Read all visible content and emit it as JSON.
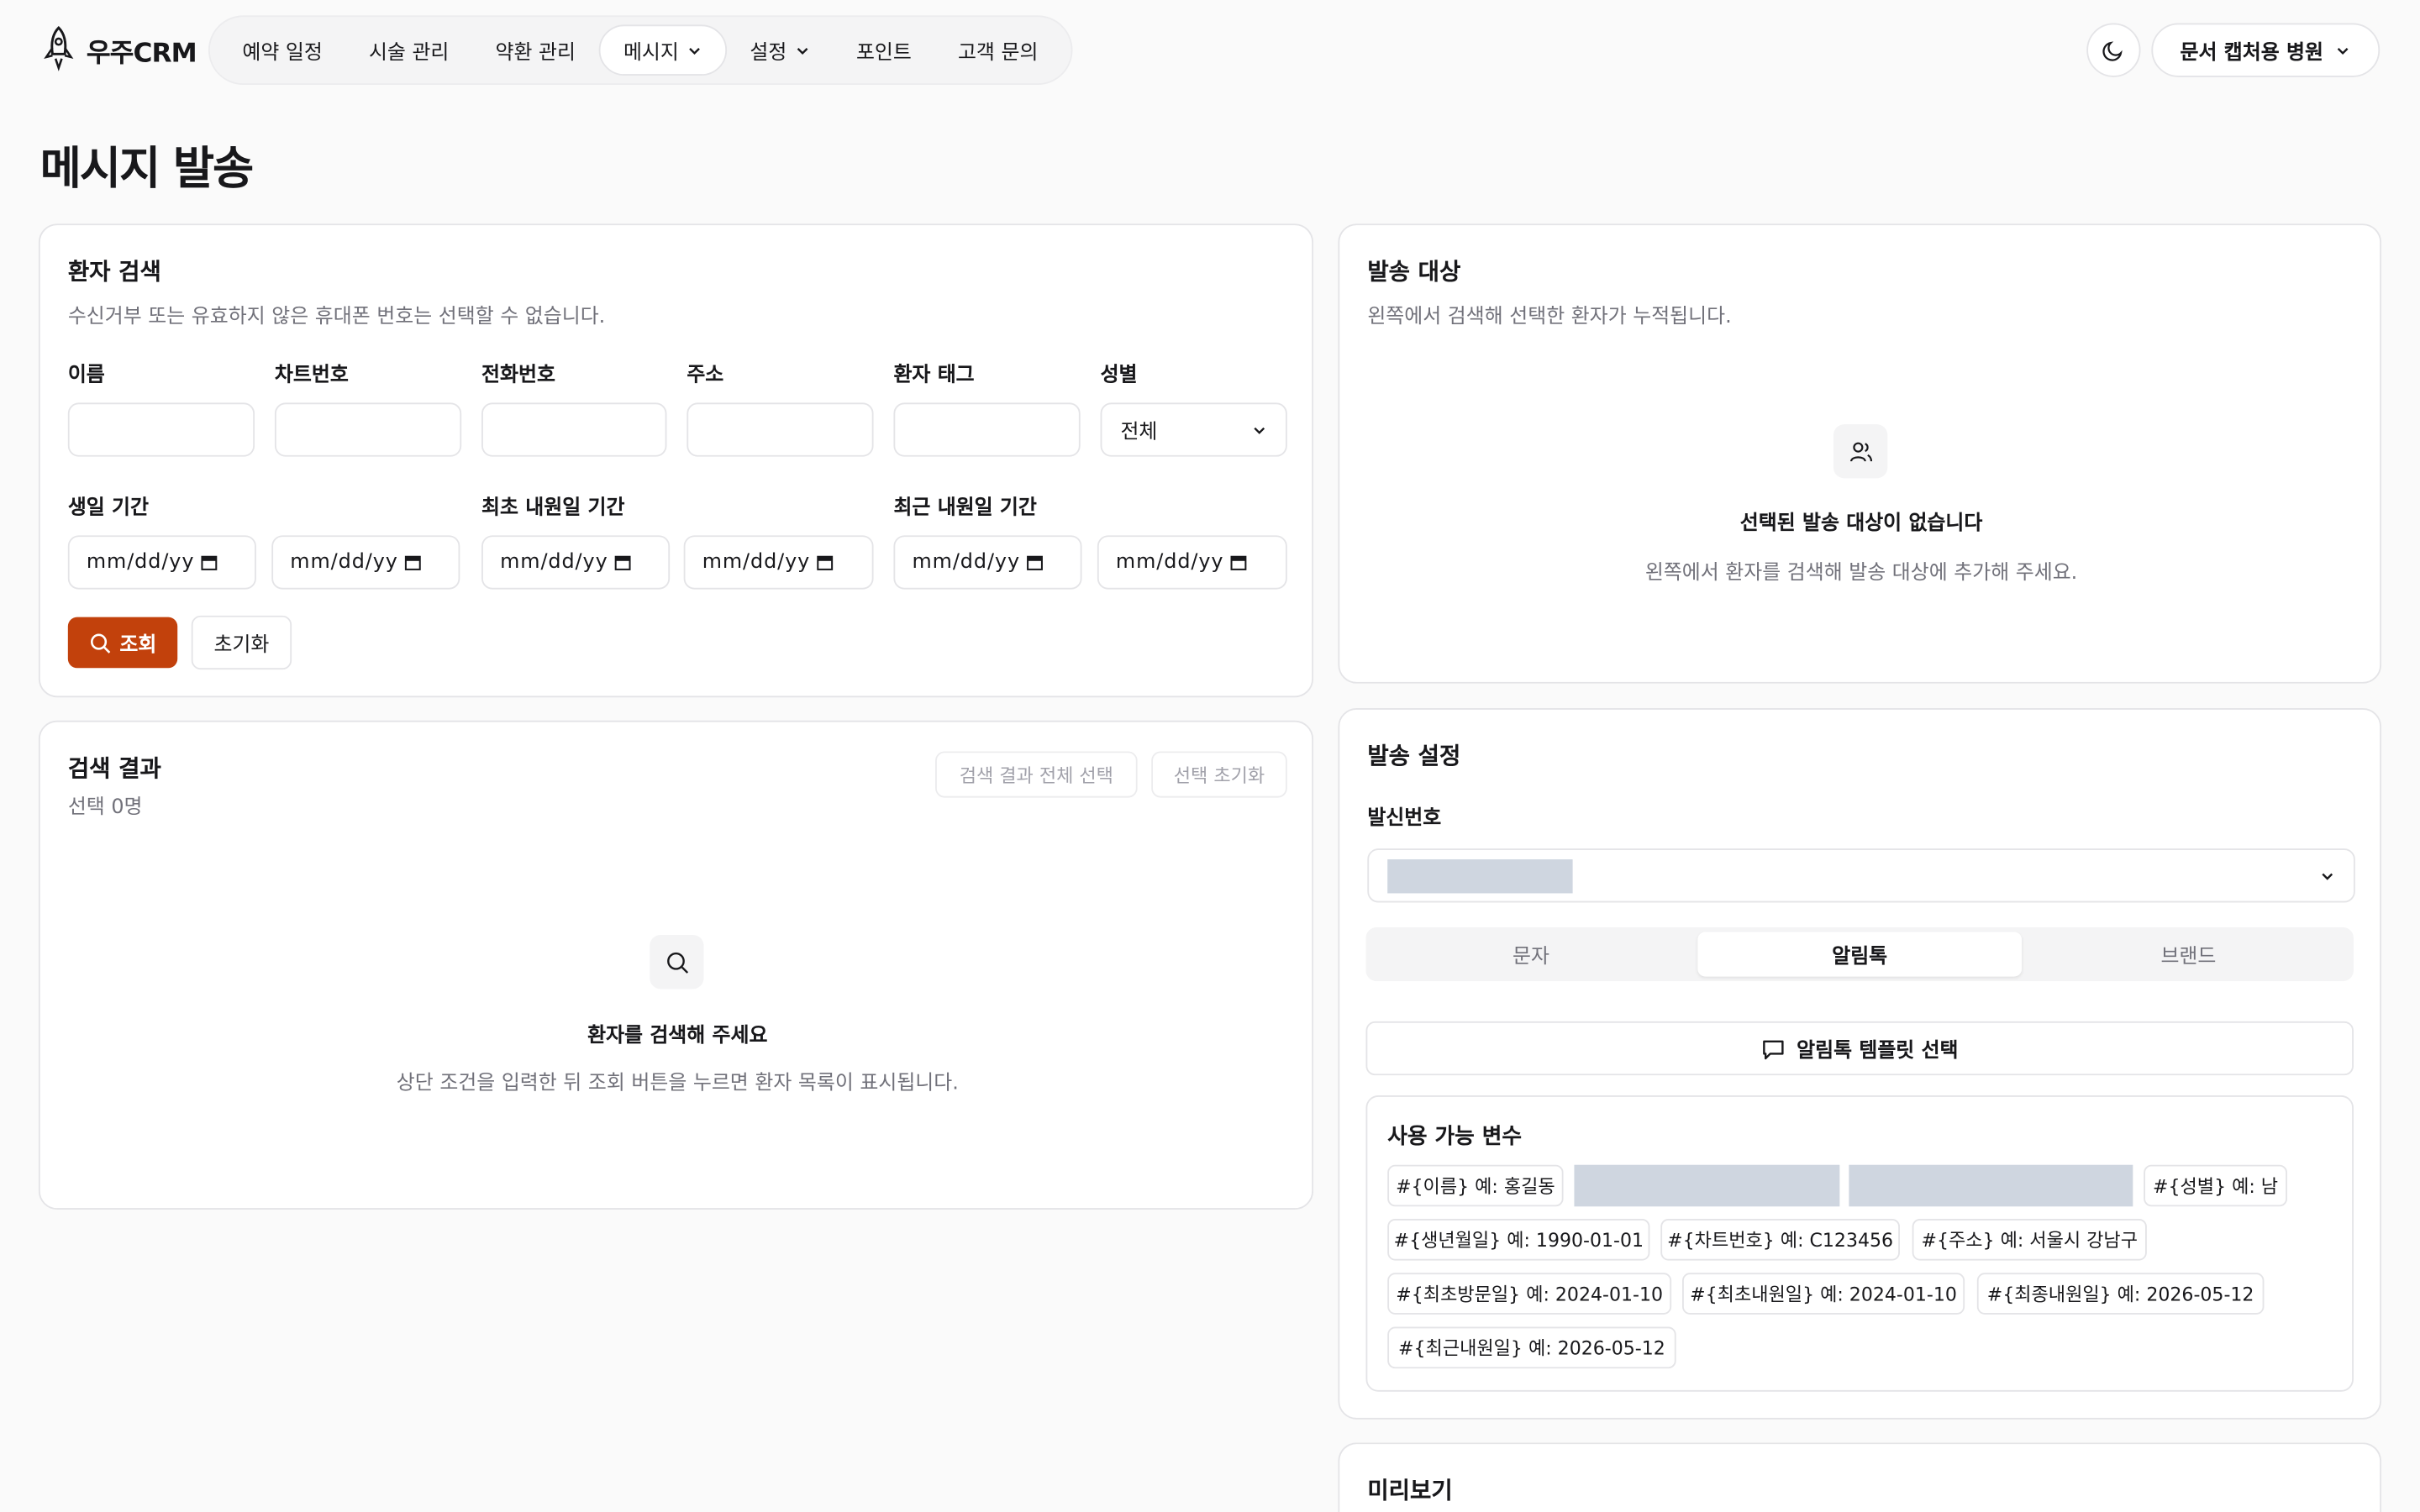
{
  "header": {
    "logo_text": "우주CRM",
    "nav": [
      {
        "label": "예약 일정"
      },
      {
        "label": "시술 관리"
      },
      {
        "label": "약환 관리"
      },
      {
        "label": "메시지"
      },
      {
        "label": "설정"
      },
      {
        "label": "포인트"
      },
      {
        "label": "고객 문의"
      }
    ],
    "hospital": "문서 캡처용 병원",
    "theme_icon": "moon-icon"
  },
  "page_title": "메시지 발송",
  "search": {
    "title": "환자 검색",
    "subtitle": "수신거부 또는 유효하지 않은 휴대폰 번호는 선택할 수 없습니다.",
    "fields": {
      "name": "이름",
      "chart": "차트번호",
      "phone": "전화번호",
      "address": "주소",
      "tag": "환자 태그",
      "gender": "성별"
    },
    "gender_value": "전체",
    "birth_label": "생일 기간",
    "first_visit_label": "최초 내원일 기간",
    "recent_visit_label": "최근 내원일 기간",
    "date_placeholder": "mm/dd/yy",
    "search_btn": "조회",
    "reset_btn": "초기화"
  },
  "results": {
    "title": "검색 결과",
    "count": "선택 0명",
    "select_all": "검색 결과 전체 선택",
    "reset_selection": "선택 초기화",
    "empty_title": "환자를 검색해 주세요",
    "empty_sub": "상단 조건을 입력한 뒤 조회 버튼을 누르면 환자 목록이 표시됩니다."
  },
  "targets": {
    "title": "발송 대상",
    "subtitle": "왼쪽에서 검색해 선택한 환자가 누적됩니다.",
    "empty_title": "선택된 발송 대상이 없습니다",
    "empty_sub": "왼쪽에서 환자를 검색해 발송 대상에 추가해 주세요."
  },
  "settings": {
    "title": "발송 설정",
    "sender_label": "발신번호",
    "tabs": [
      {
        "label": "문자"
      },
      {
        "label": "알림톡"
      },
      {
        "label": "브랜드"
      }
    ],
    "template_btn": "알림톡 템플릿 선택",
    "vars_title": "사용 가능 변수",
    "vars": [
      "#{이름} 예: 홍길동",
      "#{성별} 예: 남",
      "#{생년월일} 예: 1990-01-01",
      "#{차트번호} 예: C123456",
      "#{주소} 예: 서울시 강남구",
      "#{최초방문일} 예: 2024-01-10",
      "#{최초내원일} 예: 2024-01-10",
      "#{최종내원일} 예: 2026-05-12",
      "#{최근내원일} 예: 2026-05-12"
    ]
  },
  "preview": {
    "title": "미리보기"
  },
  "colors": {
    "accent": "#c2410c",
    "border": "#e4e4e7",
    "muted": "#71717a"
  }
}
